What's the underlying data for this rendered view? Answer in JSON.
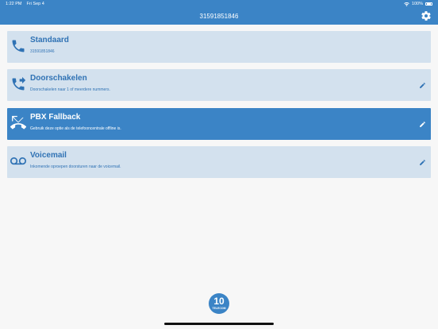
{
  "statusbar": {
    "time": "1:22 PM",
    "date": "Fri Sep 4",
    "battery": "100%",
    "wifi_icon": "wifi-icon",
    "battery_icon": "battery-icon"
  },
  "navbar": {
    "title": "31591851846",
    "settings_icon": "gear-icon"
  },
  "options": [
    {
      "title": "Standaard",
      "subtitle": "31591851846",
      "icon": "phone-icon",
      "selected": false,
      "editable": false
    },
    {
      "title": "Doorschakelen",
      "subtitle": "Doorschakelen naar 1 of meerdere nummers.",
      "icon": "call-forward-icon",
      "selected": false,
      "editable": true
    },
    {
      "title": "PBX Fallback",
      "subtitle": "Gebruik deze optie als de telefooncentrale offline is.",
      "icon": "call-missed-icon",
      "selected": true,
      "editable": true
    },
    {
      "title": "Voicemail",
      "subtitle": "Inkomende oproepen doorsturen naar de voicemail.",
      "icon": "voicemail-icon",
      "selected": false,
      "editable": true
    }
  ],
  "logo": {
    "number": "10",
    "brand": "TELECOM"
  },
  "colors": {
    "primary": "#3b84c6",
    "card_bg": "#d3e1ee",
    "text_blue": "#2f72b4",
    "page_bg": "#f7f7f7"
  }
}
